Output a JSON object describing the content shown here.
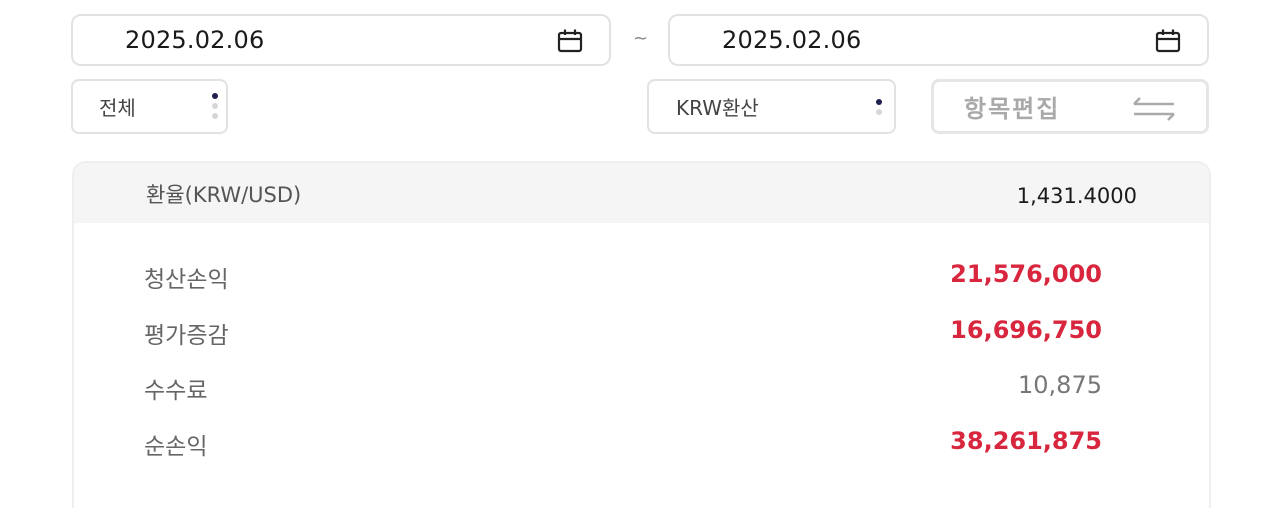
{
  "date_range": {
    "start": "2025.02.06",
    "separator": "~",
    "end": "2025.02.06",
    "icon": "calendar-icon"
  },
  "filters": {
    "category_value": "전체",
    "currency_value": "KRW환산",
    "edit_label": "항목편집",
    "edit_icon": "swap-arrows-icon"
  },
  "summary": {
    "exchange_rate_label": "환율(KRW/USD)",
    "exchange_rate_value": "1,431.4000",
    "rows": [
      {
        "label": "청산손익",
        "value": "21,576,000",
        "color": "#d7263d"
      },
      {
        "label": "평가증감",
        "value": "16,696,750",
        "color": "#d7263d"
      },
      {
        "label": "수수료",
        "value": "10,875",
        "color": "#777777"
      },
      {
        "label": "순손익",
        "value": "38,261,875",
        "color": "#d7263d"
      }
    ]
  },
  "colors": {
    "profit": "#d7263d",
    "neutral": "#777777",
    "dot_active": "#1f1f4f",
    "dot_inactive": "#d6d6d6"
  }
}
